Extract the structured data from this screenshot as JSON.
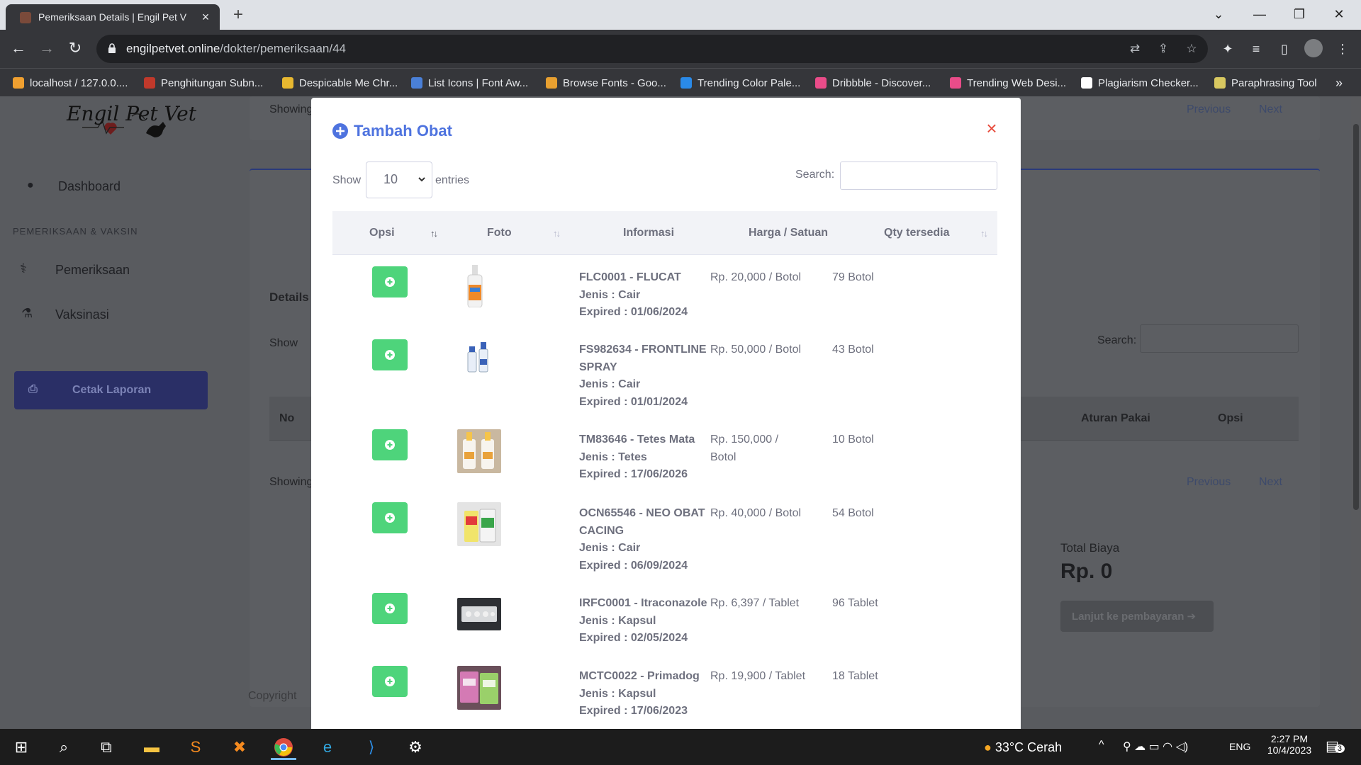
{
  "browser": {
    "tab_title": "Pemeriksaan Details | Engil Pet V",
    "url_domain": "engilpetvet.online",
    "url_path": "/dokter/pemeriksaan/44",
    "bookmarks": [
      {
        "label": "localhost / 127.0.0....",
        "color": "#f0a030"
      },
      {
        "label": "Penghitungan Subn...",
        "color": "#c0392b"
      },
      {
        "label": "Despicable Me Chr...",
        "color": "#e8b830"
      },
      {
        "label": "List Icons | Font Aw...",
        "color": "#4a80d8"
      },
      {
        "label": "Browse Fonts - Goo...",
        "color": "#e8a030"
      },
      {
        "label": "Trending Color Pale...",
        "color": "#2a8ae8"
      },
      {
        "label": "Dribbble - Discover...",
        "color": "#ea4c89"
      },
      {
        "label": "Trending Web Desi...",
        "color": "#ea4c89"
      },
      {
        "label": "Plagiarism Checker...",
        "color": "#ffffff"
      },
      {
        "label": "Paraphrasing Tool",
        "color": "#d8c860"
      }
    ]
  },
  "sidebar": {
    "logo_text": "Engil Pet Vet",
    "dashboard": "Dashboard",
    "section_heading": "PEMERIKSAAN & VAKSIN",
    "pemeriksaan": "Pemeriksaan",
    "vaksinasi": "Vaksinasi",
    "cetak": "Cetak Laporan"
  },
  "background": {
    "showing": "Showing",
    "previous": "Previous",
    "next": "Next",
    "details": "Details",
    "show": "Show",
    "search": "Search:",
    "col_no": "No",
    "col_aturan": "Aturan Pakai",
    "col_opsi": "Opsi",
    "total_label": "Total Biaya",
    "total_value": "Rp. 0",
    "pay_button": "Lanjut ke pembayaran",
    "copyright": "Copyright"
  },
  "modal": {
    "title": "Tambah Obat",
    "show_label": "Show",
    "entries_label": "entries",
    "page_length": "10",
    "search_label": "Search:",
    "search_value": "",
    "columns": [
      "Opsi",
      "Foto",
      "Informasi",
      "Harga / Satuan",
      "Qty tersedia"
    ],
    "rows": [
      {
        "code": "FLC0001 - FLUCAT",
        "jenis": "Jenis : Cair",
        "expired": "Expired : 01/06/2024",
        "harga": "Rp. 20,000 / Botol",
        "qty": "79 Botol"
      },
      {
        "code": "FS982634 - FRONTLINE SPRAY",
        "jenis": "Jenis : Cair",
        "expired": "Expired : 01/01/2024",
        "harga": "Rp. 50,000 / Botol",
        "qty": "43 Botol"
      },
      {
        "code": "TM83646 - Tetes Mata",
        "jenis": "Jenis : Tetes",
        "expired": "Expired : 17/06/2026",
        "harga": "Rp. 150,000 / Botol",
        "qty": "10 Botol"
      },
      {
        "code": "OCN65546 - NEO OBAT CACING",
        "jenis": "Jenis : Cair",
        "expired": "Expired : 06/09/2024",
        "harga": "Rp. 40,000 / Botol",
        "qty": "54 Botol"
      },
      {
        "code": "IRFC0001 - Itraconazole",
        "jenis": "Jenis : Kapsul",
        "expired": "Expired : 02/05/2024",
        "harga": "Rp. 6,397 / Tablet",
        "qty": "96 Tablet"
      },
      {
        "code": "MCTC0022 - Primadog",
        "jenis": "Jenis : Kapsul",
        "expired": "Expired : 17/06/2023",
        "harga": "Rp. 19,900 / Tablet",
        "qty": "18 Tablet"
      }
    ]
  },
  "taskbar": {
    "weather": "33°C  Cerah",
    "lang": "ENG",
    "time": "2:27 PM",
    "date": "10/4/2023",
    "notifications": "3"
  }
}
